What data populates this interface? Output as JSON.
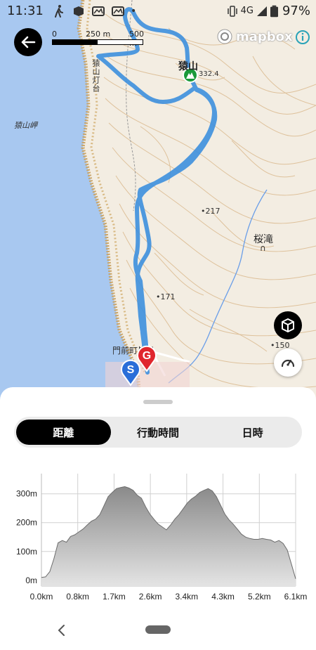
{
  "status_bar": {
    "time": "11:31",
    "network": "4G",
    "battery": "97%"
  },
  "map": {
    "scale_labels": [
      "0",
      "250 m",
      "500 m"
    ],
    "attribution": "mapbox",
    "labels": {
      "cape": "猿山岬",
      "lighthouse": "猿山灯台",
      "summit_name": "猿山",
      "summit_elev": "332.4",
      "spot_217": "217",
      "spot_171": "171",
      "spot_150": "150",
      "falls": "桜滝",
      "village": "門前町皆月"
    },
    "colors": {
      "sea": "#a8c8f0",
      "route": "#3d8fde",
      "goal": "#e0262d",
      "start": "#2a6ed8",
      "summit_marker": "#1a9a3a"
    }
  },
  "sheet": {
    "tabs": [
      {
        "label": "距離",
        "active": true
      },
      {
        "label": "行動時間",
        "active": false
      },
      {
        "label": "日時",
        "active": false
      }
    ]
  },
  "chart_data": {
    "type": "area",
    "xlabel": "",
    "ylabel": "",
    "x_ticks": [
      "0.0km",
      "0.8km",
      "1.7km",
      "2.6km",
      "3.4km",
      "4.3km",
      "5.2km",
      "6.1km"
    ],
    "y_ticks": [
      "0m",
      "100m",
      "200m",
      "300m"
    ],
    "xlim": [
      0,
      6.1
    ],
    "ylim": [
      -20,
      370
    ],
    "grid": true,
    "x": [
      0.0,
      0.1,
      0.2,
      0.3,
      0.4,
      0.5,
      0.6,
      0.7,
      0.8,
      0.9,
      1.0,
      1.1,
      1.2,
      1.3,
      1.4,
      1.5,
      1.6,
      1.7,
      1.8,
      1.9,
      2.0,
      2.1,
      2.2,
      2.3,
      2.4,
      2.5,
      2.6,
      2.7,
      2.8,
      2.9,
      3.0,
      3.1,
      3.2,
      3.3,
      3.4,
      3.5,
      3.6,
      3.7,
      3.8,
      3.9,
      4.0,
      4.1,
      4.2,
      4.3,
      4.4,
      4.5,
      4.6,
      4.7,
      4.8,
      4.9,
      5.0,
      5.1,
      5.2,
      5.3,
      5.4,
      5.5,
      5.6,
      5.7,
      5.8,
      5.9,
      6.0,
      6.1
    ],
    "y": [
      10,
      12,
      30,
      75,
      130,
      138,
      132,
      152,
      158,
      168,
      178,
      192,
      205,
      212,
      228,
      258,
      290,
      305,
      318,
      322,
      325,
      320,
      312,
      295,
      285,
      255,
      230,
      212,
      195,
      185,
      175,
      192,
      212,
      228,
      248,
      268,
      282,
      292,
      305,
      312,
      318,
      310,
      290,
      260,
      230,
      210,
      195,
      178,
      160,
      150,
      145,
      142,
      142,
      145,
      142,
      140,
      132,
      138,
      128,
      105,
      55,
      5
    ]
  }
}
